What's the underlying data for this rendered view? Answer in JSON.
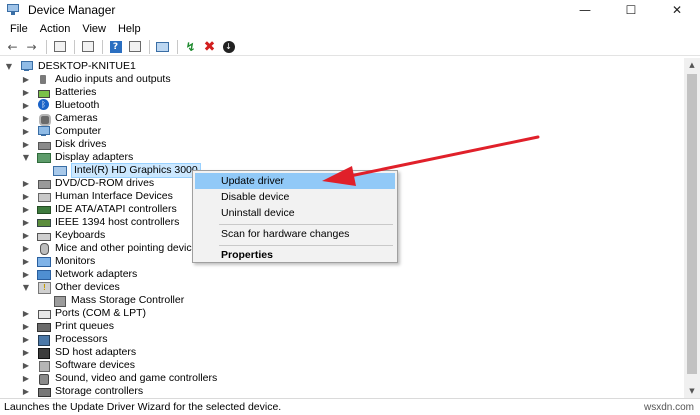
{
  "window": {
    "title": "Device Manager",
    "controls": {
      "minimize": "—",
      "maximize": "☐",
      "close": "✕"
    }
  },
  "menu": [
    "File",
    "Action",
    "View",
    "Help"
  ],
  "toolbar": {
    "back": "←",
    "forward": "→",
    "help_glyph": "?",
    "scan_glyph": "↯",
    "uninstall_glyph": "✖",
    "update_glyph": "↓"
  },
  "tree": {
    "root": "DESKTOP-KNITUE1",
    "categories": [
      {
        "label": "Audio inputs and outputs",
        "icon": "audio-icon",
        "expanded": false
      },
      {
        "label": "Batteries",
        "icon": "battery-icon",
        "expanded": false
      },
      {
        "label": "Bluetooth",
        "icon": "bluetooth-icon",
        "expanded": false
      },
      {
        "label": "Cameras",
        "icon": "camera-icon",
        "expanded": false
      },
      {
        "label": "Computer",
        "icon": "computer-icon",
        "expanded": false
      },
      {
        "label": "Disk drives",
        "icon": "disk-drive-icon",
        "expanded": false
      },
      {
        "label": "Display adapters",
        "icon": "display-adapter-icon",
        "expanded": true,
        "children": [
          "Intel(R) HD Graphics 3000"
        ]
      },
      {
        "label": "DVD/CD-ROM drives",
        "icon": "dvd-icon",
        "expanded": false
      },
      {
        "label": "Human Interface Devices",
        "icon": "hid-icon",
        "expanded": false
      },
      {
        "label": "IDE ATA/ATAPI controllers",
        "icon": "ide-icon",
        "expanded": false
      },
      {
        "label": "IEEE 1394 host controllers",
        "icon": "ieee1394-icon",
        "expanded": false
      },
      {
        "label": "Keyboards",
        "icon": "keyboard-icon",
        "expanded": false
      },
      {
        "label": "Mice and other pointing devices",
        "icon": "mouse-icon",
        "expanded": false
      },
      {
        "label": "Monitors",
        "icon": "monitor-icon",
        "expanded": false
      },
      {
        "label": "Network adapters",
        "icon": "network-icon",
        "expanded": false
      },
      {
        "label": "Other devices",
        "icon": "other-devices-icon",
        "expanded": true,
        "children": [
          "Mass Storage Controller"
        ]
      },
      {
        "label": "Ports (COM & LPT)",
        "icon": "ports-icon",
        "expanded": false
      },
      {
        "label": "Print queues",
        "icon": "printer-icon",
        "expanded": false
      },
      {
        "label": "Processors",
        "icon": "processor-icon",
        "expanded": false
      },
      {
        "label": "SD host adapters",
        "icon": "sd-icon",
        "expanded": false
      },
      {
        "label": "Software devices",
        "icon": "software-icon",
        "expanded": false
      },
      {
        "label": "Sound, video and game controllers",
        "icon": "sound-icon",
        "expanded": false
      },
      {
        "label": "Storage controllers",
        "icon": "storage-controller-icon",
        "expanded": false
      }
    ]
  },
  "context_menu": {
    "items": [
      {
        "label": "Update driver",
        "highlighted": true
      },
      {
        "label": "Disable device"
      },
      {
        "label": "Uninstall device"
      },
      {
        "label": "Scan for hardware changes"
      },
      {
        "label": "Properties",
        "bold": true
      }
    ]
  },
  "status": {
    "text": "Launches the Update Driver Wizard for the selected device.",
    "watermark": "wsxdn.com"
  },
  "colors": {
    "selection": "#cce8ff",
    "menu_hover": "#91c9f7",
    "annotation_arrow": "#e0202a"
  }
}
